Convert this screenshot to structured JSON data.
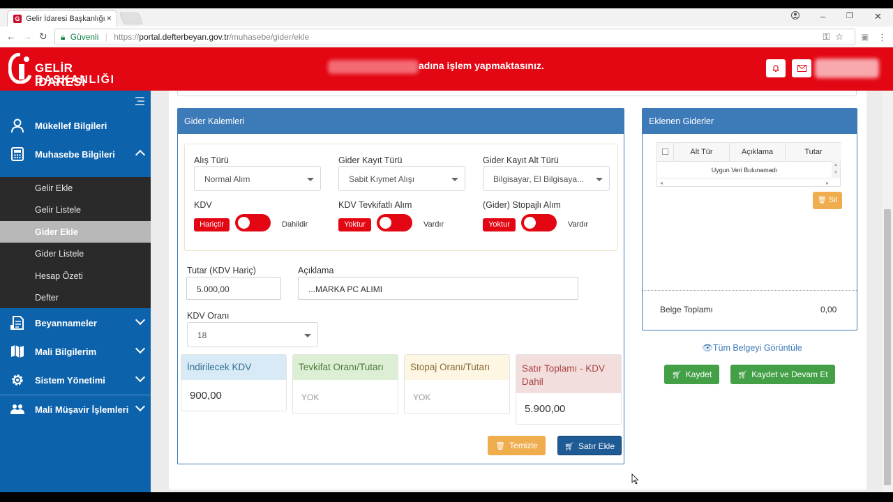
{
  "browser": {
    "tab_title": "Gelir İdaresi Başkanlığı -",
    "tab_close": "×",
    "secure_label": "Güvenli",
    "url_protocol": "https://",
    "url_host": "portal.defterbeyan.gov.tr",
    "url_path": "/muhasebe/gider/ekle",
    "window_minimize": "–",
    "window_maximize": "❐",
    "window_close": "✕"
  },
  "header": {
    "logo_line1": "GELİR İDARESİ",
    "logo_line2": "BAŞKANLIĞI",
    "acting_text": "adına işlem yapmaktasınız.",
    "colors": {
      "brand_red": "#e30613",
      "sidebar_blue": "#0d62ac",
      "panel_blue": "#3d7ab8"
    }
  },
  "sidebar": {
    "items": [
      {
        "label": "Mükellef Bilgileri",
        "icon": "user-icon"
      },
      {
        "label": "Muhasebe Bilgileri",
        "icon": "calculator-icon"
      },
      {
        "label": "Beyannameler",
        "icon": "document-icon"
      },
      {
        "label": "Mali Bilgilerim",
        "icon": "map-icon"
      },
      {
        "label": "Sistem Yönetimi",
        "icon": "gear-icon"
      },
      {
        "label": "Mali Müşavir İşlemleri",
        "icon": "users-icon"
      }
    ],
    "submenu": [
      {
        "label": "Gelir Ekle"
      },
      {
        "label": "Gelir Listele"
      },
      {
        "label": "Gider Ekle",
        "active": true
      },
      {
        "label": "Gider Listele"
      },
      {
        "label": "Hesap Özeti"
      },
      {
        "label": "Defter"
      }
    ]
  },
  "gider_kalemleri": {
    "title": "Gider Kalemleri",
    "alis_turu": {
      "label": "Alış Türü",
      "value": "Normal Alım"
    },
    "gider_kayit_turu": {
      "label": "Gider Kayıt Türü",
      "value": "Sabit Kıymet Alışı"
    },
    "gider_kayit_alt_turu": {
      "label": "Gider Kayıt Alt Türü",
      "value": "Bilgisayar, El Bilgisaya..."
    },
    "kdv": {
      "label": "KDV",
      "tag": "Hariçtir",
      "alt": "Dahildir"
    },
    "kdv_tevkifatli": {
      "label": "KDV Tevkifatlı Alım",
      "tag": "Yoktur",
      "alt": "Vardır"
    },
    "stopajli": {
      "label": "(Gider) Stopajlı Alım",
      "tag": "Yoktur",
      "alt": "Vardır"
    },
    "tutar": {
      "label": "Tutar (KDV Hariç)",
      "value": "5.000,00"
    },
    "aciklama": {
      "label": "Açıklama",
      "value": "...MARKA PC ALIMI"
    },
    "kdv_orani": {
      "label": "KDV Oranı",
      "value": "18"
    },
    "boxes": {
      "indirilecek": {
        "title": "İndirilecek KDV",
        "value": "900,00"
      },
      "tevkifat": {
        "title": "Tevkifat Oranı/Tutarı",
        "value": "YOK"
      },
      "stopaj": {
        "title": "Stopaj Oranı/Tutarı",
        "value": "YOK"
      },
      "satir_toplami": {
        "title": "Satır Toplamı - KDV Dahil",
        "value": "5.900,00"
      }
    },
    "buttons": {
      "temizle": "Temizle",
      "satir_ekle": "Satır Ekle"
    }
  },
  "eklenen_giderler": {
    "title": "Eklenen Giderler",
    "columns": [
      "Alt Tür",
      "Açıklama",
      "Tutar"
    ],
    "empty_text": "Uygun Veri Bulunamadı",
    "sil_label": "Sil",
    "belge_toplami_label": "Belge Toplamı",
    "belge_toplami_value": "0,00"
  },
  "actions": {
    "tum_belge": "Tüm Belgeyi Görüntüle",
    "kaydet": "Kaydet",
    "kaydet_devam": "Kaydet ve Devam Et"
  }
}
